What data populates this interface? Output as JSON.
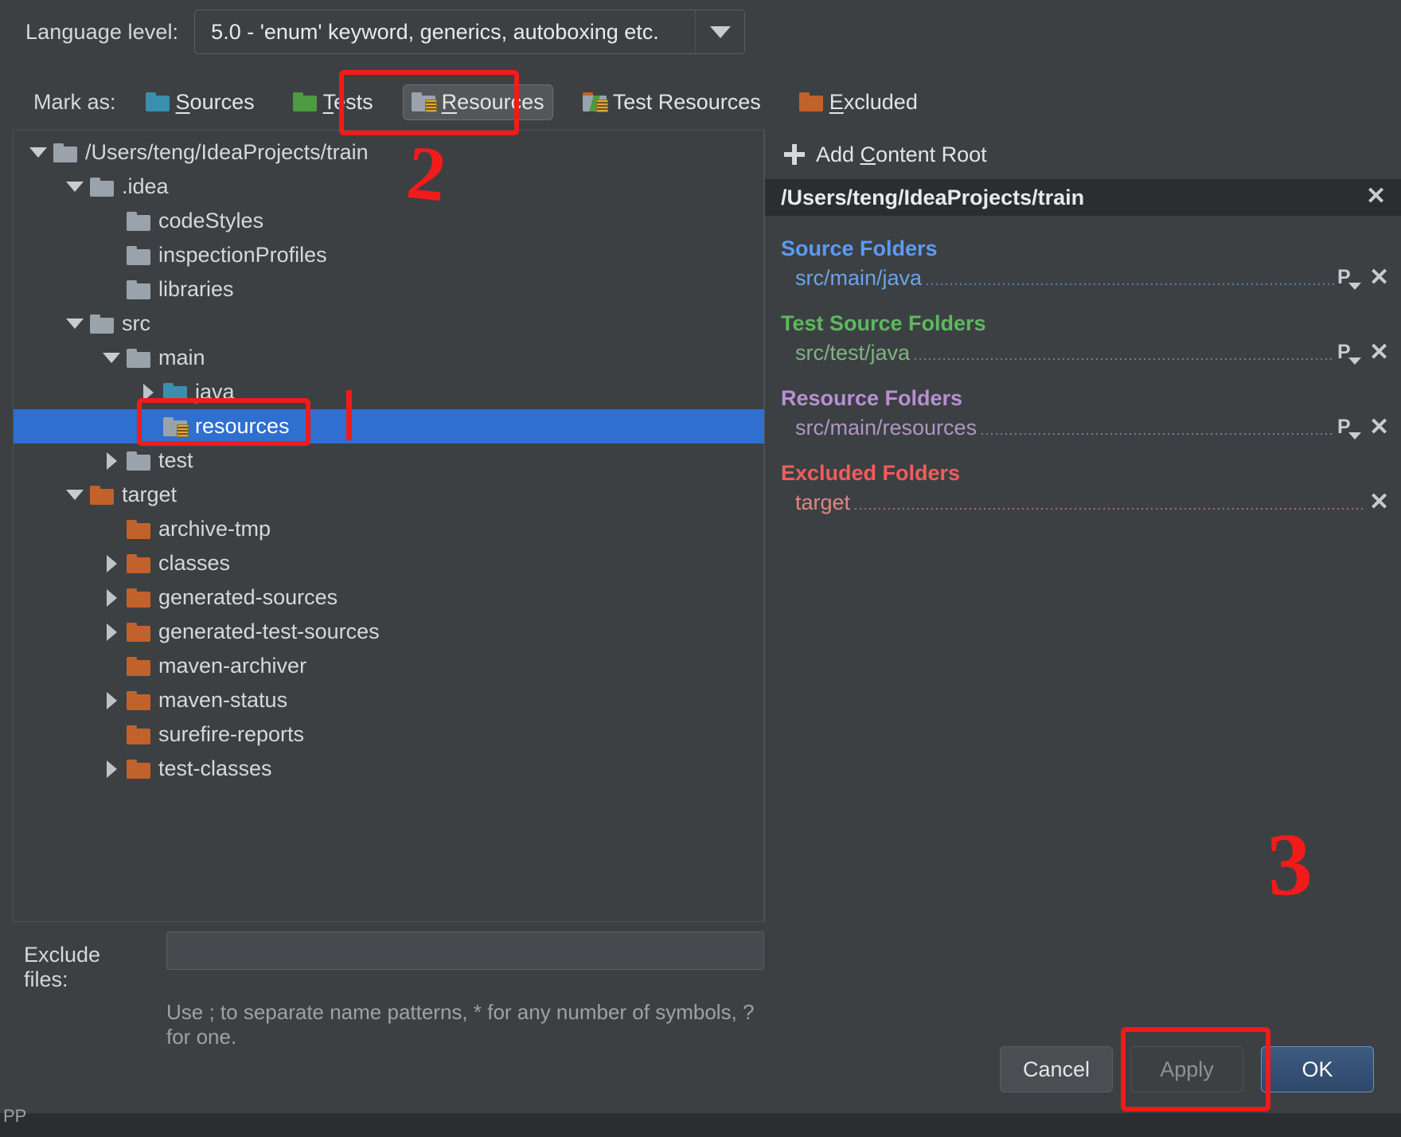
{
  "language_level": {
    "label": "Language level:",
    "value": "5.0 - 'enum' keyword, generics, autoboxing etc.",
    "arrow_icon": "chevron-down-icon"
  },
  "mark_as": {
    "label": "Mark as:",
    "options": [
      {
        "label": "Sources",
        "folder": "blue",
        "selected": false,
        "mnemonic": "S"
      },
      {
        "label": "Tests",
        "folder": "green",
        "selected": false,
        "mnemonic": "T"
      },
      {
        "label": "Resources",
        "folder": "grey",
        "selected": true,
        "mnemonic": "R"
      },
      {
        "label": "Test Resources",
        "folder": "tr",
        "selected": false,
        "mnemonic": ""
      },
      {
        "label": "Excluded",
        "folder": "orange",
        "selected": false,
        "mnemonic": "E"
      }
    ]
  },
  "tree": [
    {
      "label": "/Users/teng/IdeaProjects/train",
      "indent": 0,
      "twisty": "down",
      "folder": "grey",
      "res": false,
      "selected": false
    },
    {
      "label": ".idea",
      "indent": 1,
      "twisty": "down",
      "folder": "grey",
      "res": false,
      "selected": false
    },
    {
      "label": "codeStyles",
      "indent": 2,
      "twisty": "none",
      "folder": "grey",
      "res": false,
      "selected": false
    },
    {
      "label": "inspectionProfiles",
      "indent": 2,
      "twisty": "none",
      "folder": "grey",
      "res": false,
      "selected": false
    },
    {
      "label": "libraries",
      "indent": 2,
      "twisty": "none",
      "folder": "grey",
      "res": false,
      "selected": false
    },
    {
      "label": "src",
      "indent": 1,
      "twisty": "down",
      "folder": "grey",
      "res": false,
      "selected": false
    },
    {
      "label": "main",
      "indent": 2,
      "twisty": "down",
      "folder": "grey",
      "res": false,
      "selected": false
    },
    {
      "label": "java",
      "indent": 3,
      "twisty": "right",
      "folder": "teal",
      "res": false,
      "selected": false
    },
    {
      "label": "resources",
      "indent": 3,
      "twisty": "none",
      "folder": "grey",
      "res": true,
      "selected": true
    },
    {
      "label": "test",
      "indent": 2,
      "twisty": "right",
      "folder": "grey",
      "res": false,
      "selected": false
    },
    {
      "label": "target",
      "indent": 1,
      "twisty": "down",
      "folder": "orange",
      "res": false,
      "selected": false
    },
    {
      "label": "archive-tmp",
      "indent": 2,
      "twisty": "none",
      "folder": "orange",
      "res": false,
      "selected": false
    },
    {
      "label": "classes",
      "indent": 2,
      "twisty": "right",
      "folder": "orange",
      "res": false,
      "selected": false
    },
    {
      "label": "generated-sources",
      "indent": 2,
      "twisty": "right",
      "folder": "orange",
      "res": false,
      "selected": false
    },
    {
      "label": "generated-test-sources",
      "indent": 2,
      "twisty": "right",
      "folder": "orange",
      "res": false,
      "selected": false
    },
    {
      "label": "maven-archiver",
      "indent": 2,
      "twisty": "none",
      "folder": "orange",
      "res": false,
      "selected": false
    },
    {
      "label": "maven-status",
      "indent": 2,
      "twisty": "right",
      "folder": "orange",
      "res": false,
      "selected": false
    },
    {
      "label": "surefire-reports",
      "indent": 2,
      "twisty": "none",
      "folder": "orange",
      "res": false,
      "selected": false
    },
    {
      "label": "test-classes",
      "indent": 2,
      "twisty": "right",
      "folder": "orange",
      "res": false,
      "selected": false
    }
  ],
  "exclude": {
    "label": "Exclude files:",
    "value": "",
    "placeholder": "",
    "hint": "Use ; to separate name patterns, * for any number of symbols, ? for one."
  },
  "right_panel": {
    "add_content_root": "Add Content Root",
    "add_icon": "plus-icon",
    "content_root": "/Users/teng/IdeaProjects/train",
    "groups": [
      {
        "key": "src",
        "title": "Source Folders",
        "items": [
          {
            "path": "src/main/java",
            "has_package_prefix": true,
            "has_remove": true
          }
        ]
      },
      {
        "key": "tst",
        "title": "Test Source Folders",
        "items": [
          {
            "path": "src/test/java",
            "has_package_prefix": true,
            "has_remove": true
          }
        ]
      },
      {
        "key": "res",
        "title": "Resource Folders",
        "items": [
          {
            "path": "src/main/resources",
            "has_package_prefix": true,
            "has_remove": true
          }
        ]
      },
      {
        "key": "exc",
        "title": "Excluded Folders",
        "items": [
          {
            "path": "target",
            "has_package_prefix": false,
            "has_remove": true
          }
        ]
      }
    ],
    "package_prefix_icon": "package-prefix-icon",
    "remove_icon": "close-x-icon"
  },
  "footer": {
    "cancel": "Cancel",
    "apply": "Apply",
    "ok": "OK"
  },
  "annotations": {
    "step2": "2",
    "step3": "3",
    "highlight_color": "#f21b1b"
  },
  "bottom_strip": {
    "text": "PP"
  }
}
